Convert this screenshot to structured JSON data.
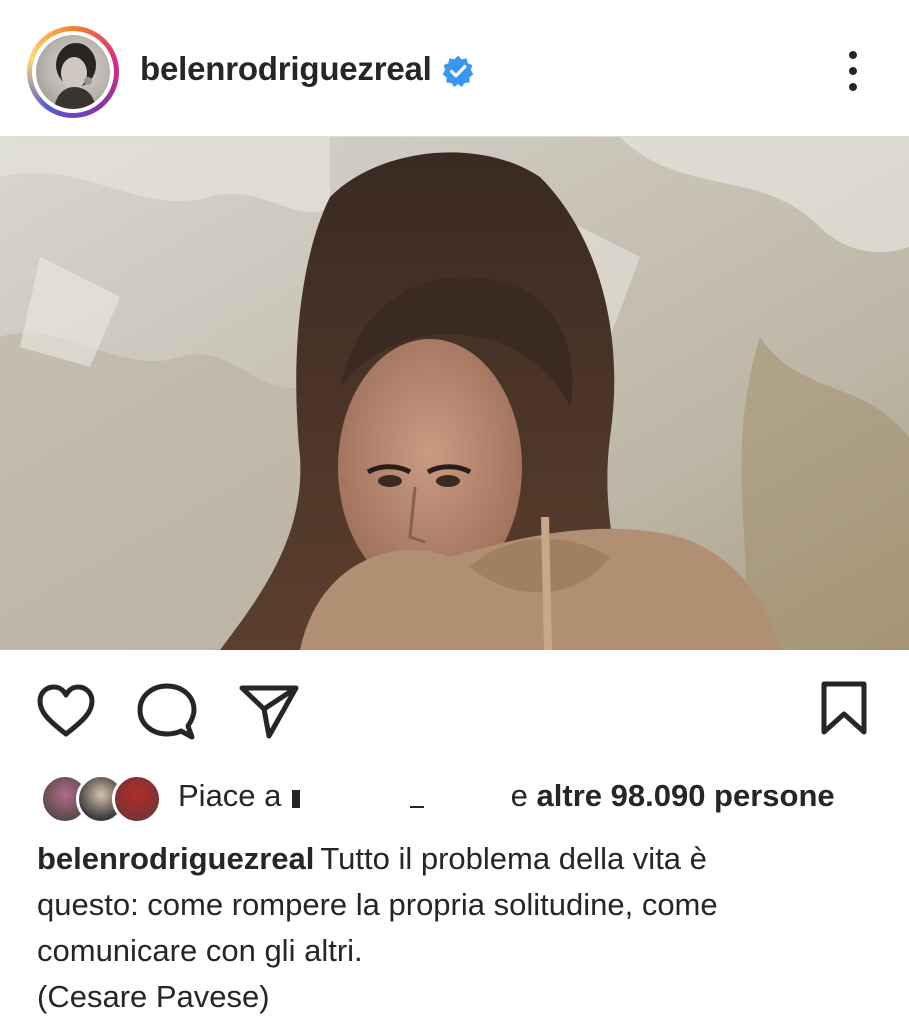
{
  "header": {
    "username": "belenrodriguezreal",
    "verified": true,
    "avatar_icon": "profile-photo",
    "more_icon": "more-vertical-icon"
  },
  "post": {
    "image_description_icon": "post-photo"
  },
  "actions": {
    "like_icon": "heart-icon",
    "comment_icon": "comment-icon",
    "share_icon": "send-icon",
    "save_icon": "bookmark-icon"
  },
  "likes": {
    "prefix": "Piace a",
    "suffix_connector": "e",
    "count_text": "altre 98.090 persone"
  },
  "caption": {
    "username": "belenrodriguezreal",
    "line1": "Tutto il problema della vita è",
    "line2": "questo: come rompere la propria solitudine, come",
    "line3": "comunicare con gli altri.",
    "line4": "(Cesare Pavese)"
  },
  "colors": {
    "text": "#262626",
    "verified_blue": "#3897f0",
    "divider": "#dbdbdb"
  }
}
